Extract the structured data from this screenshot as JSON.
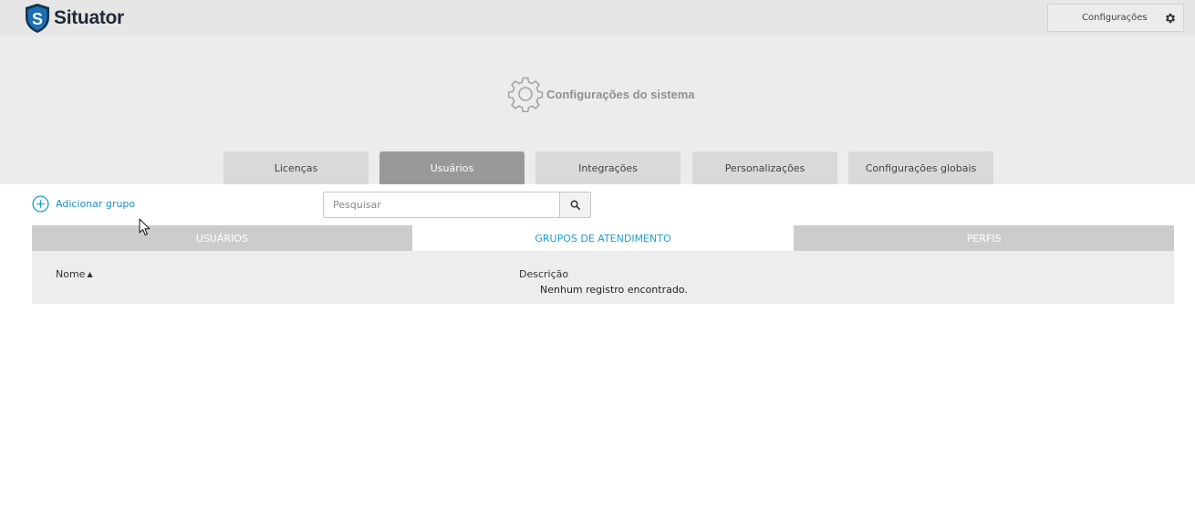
{
  "app": {
    "brand": "Situator",
    "brand_colors": {
      "shield": "#1c6fb0",
      "shield_dark": "#14324f",
      "accent": "#1a9fd6"
    }
  },
  "topbar": {
    "config_button_label": "Configurações",
    "config_icon": "gear-icon"
  },
  "header": {
    "title": "Configurações do sistema",
    "icon": "gear-icon"
  },
  "main_tabs": [
    {
      "label": "Licenças",
      "active": false
    },
    {
      "label": "Usuários",
      "active": true
    },
    {
      "label": "Integrações",
      "active": false
    },
    {
      "label": "Personalizações",
      "active": false
    },
    {
      "label": "Configurações globais",
      "active": false
    }
  ],
  "toolbar": {
    "add_group_label": "Adicionar grupo",
    "add_icon": "plus-circle-icon",
    "search_placeholder": "Pesquisar",
    "search_value": "",
    "search_icon": "search-icon"
  },
  "sub_tabs": [
    {
      "label": "USUÁRIOS",
      "active": false
    },
    {
      "label": "GRUPOS DE ATENDIMENTO",
      "active": true
    },
    {
      "label": "PERFIS",
      "active": false
    }
  ],
  "table": {
    "columns": [
      {
        "label": "Nome",
        "sort": "asc"
      },
      {
        "label": "Descrição"
      }
    ],
    "rows": [],
    "empty_message": "Nenhum registro encontrado."
  }
}
